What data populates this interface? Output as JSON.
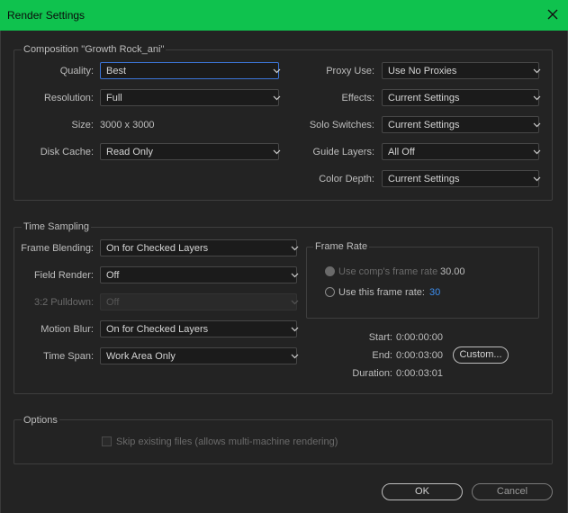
{
  "window": {
    "title": "Render Settings"
  },
  "composition": {
    "heading": "Composition \"Growth Rock_ani\"",
    "quality": {
      "label": "Quality:",
      "value": "Best"
    },
    "resolution": {
      "label": "Resolution:",
      "value": "Full"
    },
    "size": {
      "label": "Size:",
      "value": "3000 x 3000"
    },
    "disk_cache": {
      "label": "Disk Cache:",
      "value": "Read Only"
    },
    "proxy_use": {
      "label": "Proxy Use:",
      "value": "Use No Proxies"
    },
    "effects": {
      "label": "Effects:",
      "value": "Current Settings"
    },
    "solo_switches": {
      "label": "Solo Switches:",
      "value": "Current Settings"
    },
    "guide_layers": {
      "label": "Guide Layers:",
      "value": "All Off"
    },
    "color_depth": {
      "label": "Color Depth:",
      "value": "Current Settings"
    }
  },
  "time_sampling": {
    "heading": "Time Sampling",
    "frame_blending": {
      "label": "Frame Blending:",
      "value": "On for Checked Layers"
    },
    "field_render": {
      "label": "Field Render:",
      "value": "Off"
    },
    "pulldown": {
      "label": "3:2 Pulldown:",
      "value": "Off"
    },
    "motion_blur": {
      "label": "Motion Blur:",
      "value": "On for Checked Layers"
    },
    "time_span": {
      "label": "Time Span:",
      "value": "Work Area Only"
    },
    "frame_rate": {
      "heading": "Frame Rate",
      "use_comp_label": "Use comp's frame rate",
      "use_comp_value": "30.00",
      "use_this_label": "Use this frame rate:",
      "use_this_value": "30"
    },
    "start": {
      "label": "Start:",
      "value": "0:00:00:00"
    },
    "end": {
      "label": "End:",
      "value": "0:00:03:00"
    },
    "duration": {
      "label": "Duration:",
      "value": "0:00:03:01"
    },
    "custom_label": "Custom..."
  },
  "options": {
    "heading": "Options",
    "skip_existing_label": "Skip existing files (allows multi-machine rendering)"
  },
  "buttons": {
    "ok": "OK",
    "cancel": "Cancel"
  },
  "colors": {
    "title_bar": "#0fc24e",
    "background": "#232323",
    "accent_blue": "#3d8ff0",
    "focus": "#3b74d6"
  }
}
